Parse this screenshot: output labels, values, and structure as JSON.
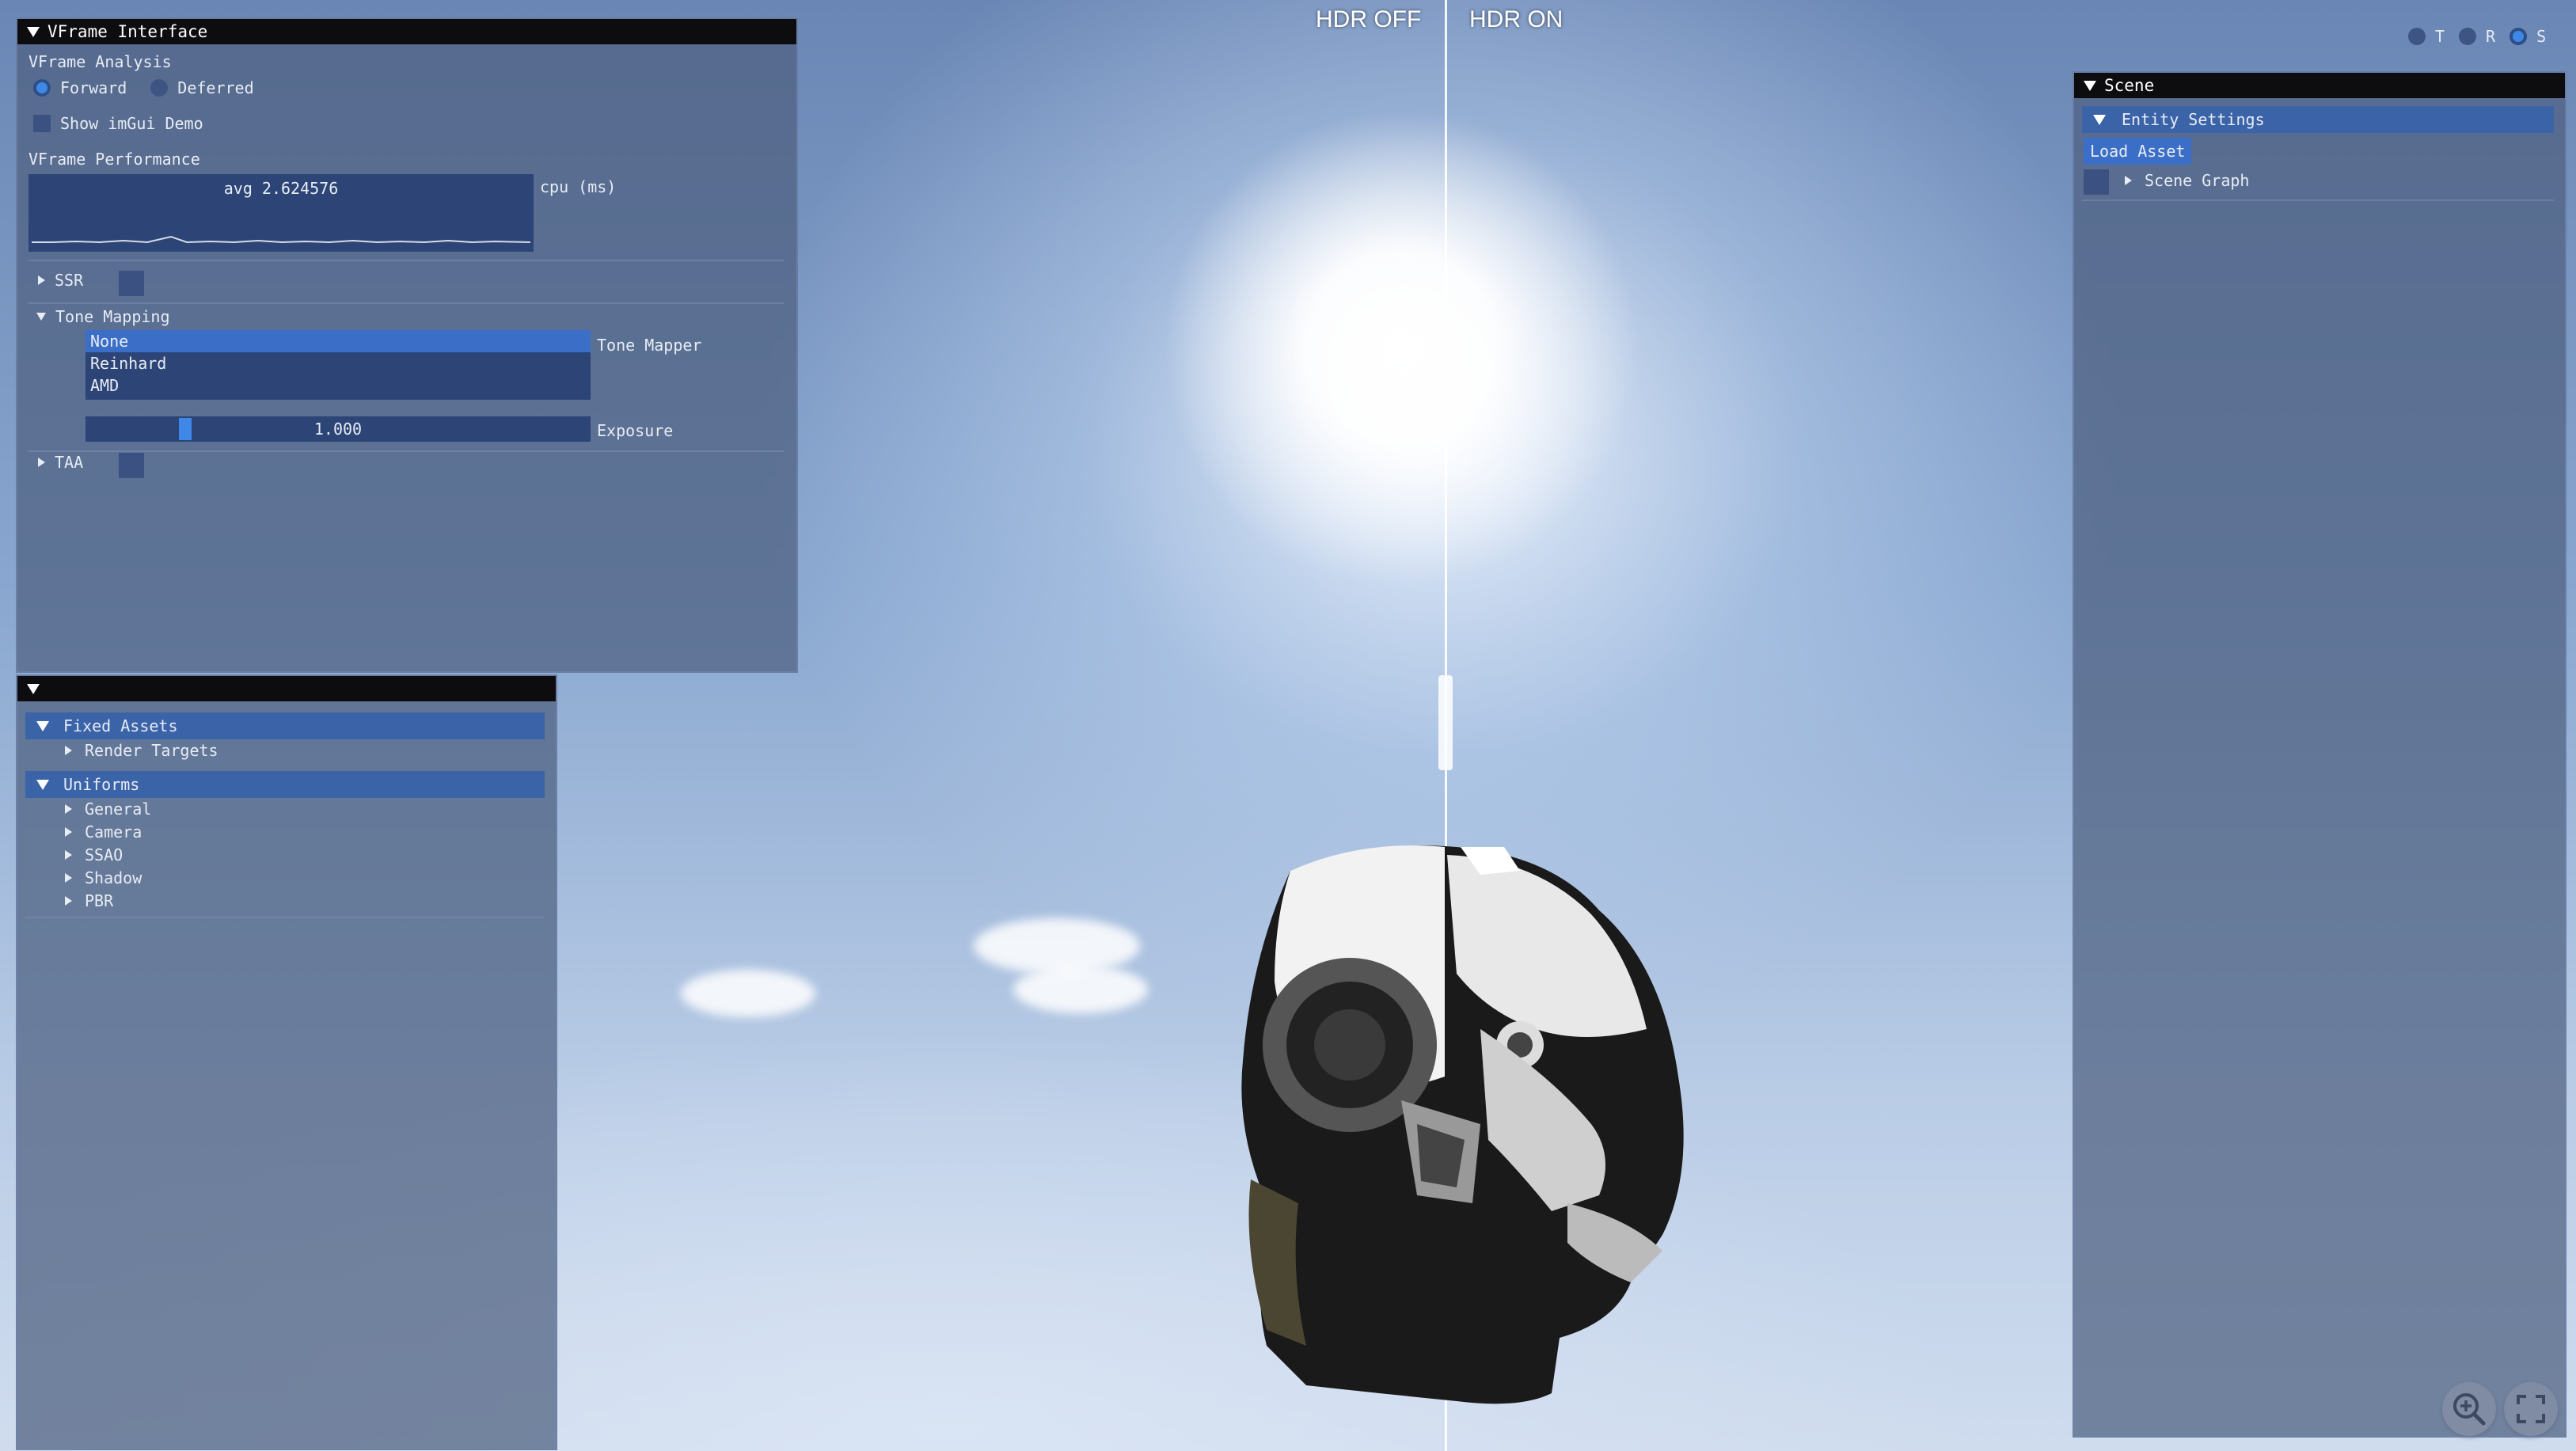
{
  "viewport": {
    "hdr_off_label": "HDR OFF",
    "hdr_on_label": "HDR ON",
    "gizmo": {
      "t_label": "T",
      "r_label": "R",
      "s_label": "S",
      "active": "S"
    }
  },
  "vframe_panel": {
    "title": "VFrame Interface",
    "analysis_header": "VFrame Analysis",
    "render_modes": [
      "Forward",
      "Deferred"
    ],
    "selected_render_mode": "Forward",
    "show_imgui_demo_label": "Show imGui Demo",
    "performance_header": "VFrame Performance",
    "plot_overlay": "avg 2.624576",
    "plot_label": "cpu (ms)",
    "ssr_label": "SSR",
    "tone_mapping_label": "Tone Mapping",
    "tone_mappers": [
      "None",
      "Reinhard",
      "AMD"
    ],
    "selected_tone_mapper": "None",
    "tone_mapper_label": "Tone Mapper",
    "exposure_value": "1.000",
    "exposure_label": "Exposure",
    "taa_label": "TAA"
  },
  "assets_panel": {
    "title": "",
    "fixed_assets_label": "Fixed Assets",
    "render_targets_label": "Render Targets",
    "uniforms_label": "Uniforms",
    "uniform_items": [
      "General",
      "Camera",
      "SSAO",
      "Shadow",
      "PBR"
    ]
  },
  "scene_panel": {
    "title": "Scene",
    "entity_settings_label": "Entity Settings",
    "load_asset_label": "Load Asset",
    "scene_graph_label": "Scene Graph"
  },
  "colors": {
    "accent": "#3f88e8",
    "panel_bg": "#4e5f80",
    "title_bar": "#0d0d0f",
    "highlight": "#3a63a8"
  }
}
